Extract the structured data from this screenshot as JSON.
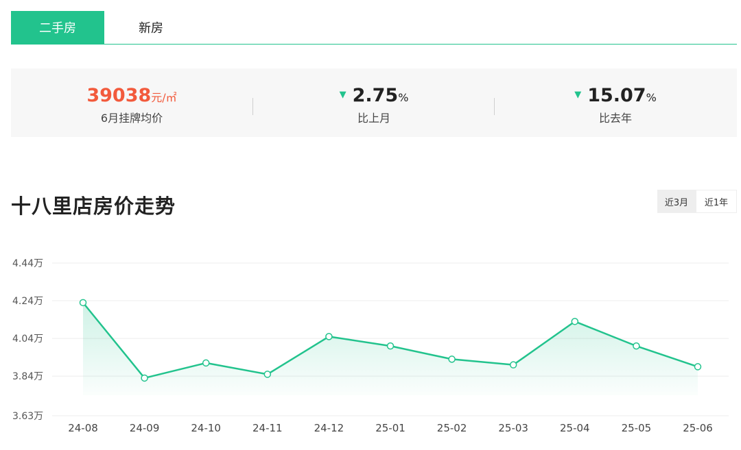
{
  "tabs": {
    "active": "二手房",
    "inactive": "新房"
  },
  "stats": {
    "price_value": "39038",
    "price_unit": "元/㎡",
    "price_label": "6月挂牌均价",
    "mom_value": "2.75",
    "mom_unit": "%",
    "mom_label": "比上月",
    "yoy_value": "15.07",
    "yoy_unit": "%",
    "yoy_label": "比去年",
    "trend_symbol": "▼"
  },
  "trend": {
    "title": "十八里店房价走势",
    "range_options": [
      "近3月",
      "近1年"
    ],
    "selected_range": "近3月"
  },
  "colors": {
    "accent": "#22c38d",
    "price": "#f25a3c",
    "gray_bg": "#f7f7f7"
  },
  "chart_data": {
    "type": "area",
    "categories": [
      "24-08",
      "24-09",
      "24-10",
      "24-11",
      "24-12",
      "25-01",
      "25-02",
      "25-03",
      "25-04",
      "25-05",
      "25-06"
    ],
    "values": [
      4.23,
      3.83,
      3.91,
      3.85,
      4.05,
      4.0,
      3.93,
      3.9,
      4.13,
      4.0,
      3.89
    ],
    "value_unit": "万",
    "yticks": [
      {
        "value": 4.44,
        "label": "4.44万"
      },
      {
        "value": 4.24,
        "label": "4.24万"
      },
      {
        "value": 4.04,
        "label": "4.04万"
      },
      {
        "value": 3.84,
        "label": "3.84万"
      },
      {
        "value": 3.63,
        "label": "3.63万"
      }
    ],
    "ylim": [
      3.63,
      4.44
    ],
    "grid": true,
    "line_color": "#22c38d"
  }
}
